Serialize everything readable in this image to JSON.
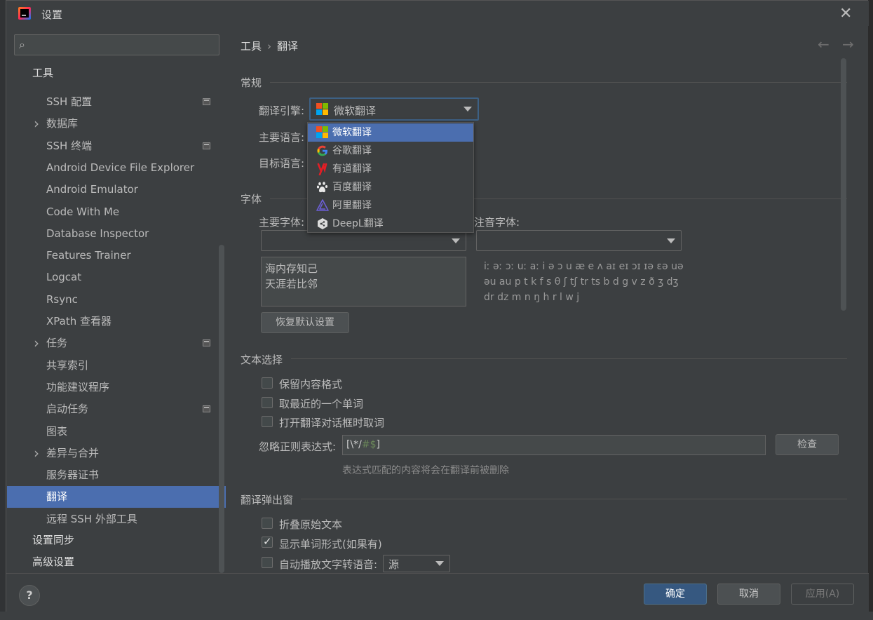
{
  "window": {
    "title": "设置"
  },
  "sidebar": {
    "search_placeholder": "",
    "root_tools": "工具",
    "items": [
      {
        "label": "SSH 配置",
        "has_children": false,
        "project": true
      },
      {
        "label": "数据库",
        "has_children": true,
        "project": false
      },
      {
        "label": "SSH 终端",
        "has_children": false,
        "project": true
      },
      {
        "label": "Android Device File Explorer",
        "has_children": false,
        "project": false
      },
      {
        "label": "Android Emulator",
        "has_children": false,
        "project": false
      },
      {
        "label": "Code With Me",
        "has_children": false,
        "project": false
      },
      {
        "label": "Database Inspector",
        "has_children": false,
        "project": false
      },
      {
        "label": "Features Trainer",
        "has_children": false,
        "project": false
      },
      {
        "label": "Logcat",
        "has_children": false,
        "project": false
      },
      {
        "label": "Rsync",
        "has_children": false,
        "project": false
      },
      {
        "label": "XPath 查看器",
        "has_children": false,
        "project": false
      },
      {
        "label": "任务",
        "has_children": true,
        "project": true
      },
      {
        "label": "共享索引",
        "has_children": false,
        "project": false
      },
      {
        "label": "功能建议程序",
        "has_children": false,
        "project": false
      },
      {
        "label": "启动任务",
        "has_children": false,
        "project": true
      },
      {
        "label": "图表",
        "has_children": false,
        "project": false
      },
      {
        "label": "差异与合并",
        "has_children": true,
        "project": false
      },
      {
        "label": "服务器证书",
        "has_children": false,
        "project": false
      },
      {
        "label": "翻译",
        "has_children": false,
        "project": false,
        "selected": true
      },
      {
        "label": "远程 SSH 外部工具",
        "has_children": false,
        "project": false
      }
    ],
    "root_sync": "设置同步",
    "root_advanced": "高级设置"
  },
  "breadcrumb": {
    "parent": "工具",
    "sep": "›",
    "current": "翻译"
  },
  "general": {
    "title": "常规",
    "engine_label": "翻译引擎:",
    "engine_value": "微软翻译",
    "primary_lang_label": "主要语言:",
    "target_lang_label": "目标语言:"
  },
  "engine_options": [
    {
      "label": "微软翻译",
      "icon": "microsoft-icon",
      "selected": true
    },
    {
      "label": "谷歌翻译",
      "icon": "google-icon"
    },
    {
      "label": "有道翻译",
      "icon": "youdao-icon"
    },
    {
      "label": "百度翻译",
      "icon": "baidu-icon"
    },
    {
      "label": "阿里翻译",
      "icon": "alibaba-icon"
    },
    {
      "label": "DeepL翻译",
      "icon": "deepl-icon"
    }
  ],
  "font": {
    "title": "字体",
    "primary_label": "主要字体:",
    "phonetic_label": "注音字体:",
    "primary_preview_line1": "海内存知己",
    "primary_preview_line2": "天涯若比邻",
    "phonetic_line1": "iː əː ɔː uː aː i ə ɔ u æ e ʌ aɪ eɪ ɔɪ ɪə ɛə uə",
    "phonetic_line2": "əu au p t k f s θ ʃ tʃ tr ts b d g v z ð ʒ dʒ",
    "phonetic_line3": "dr dz m n ŋ h r l w j",
    "reset_button": "恢复默认设置"
  },
  "text_selection": {
    "title": "文本选择",
    "keep_format": "保留内容格式",
    "take_nearest": "取最近的一个单词",
    "take_on_open": "打开翻译对话框时取词",
    "ignore_label": "忽略正则表达式:",
    "ignore_value_part1": "[\\*/",
    "ignore_value_part2": "#$",
    "ignore_value_part3": "]",
    "check_button": "检查",
    "hint": "表达式匹配的内容将会在翻译前被删除"
  },
  "popup": {
    "title": "翻译弹出窗",
    "fold_text": "折叠原始文本",
    "show_word_forms": "显示单词形式(如果有)",
    "auto_tts": "自动播放文字转语音:",
    "tts_value": "源"
  },
  "footer": {
    "help": "?",
    "ok": "确定",
    "cancel": "取消",
    "apply": "应用(A)"
  },
  "colors": {
    "selection": "#4b6eaf",
    "primary_button": "#365880",
    "background": "#3c3f41"
  }
}
